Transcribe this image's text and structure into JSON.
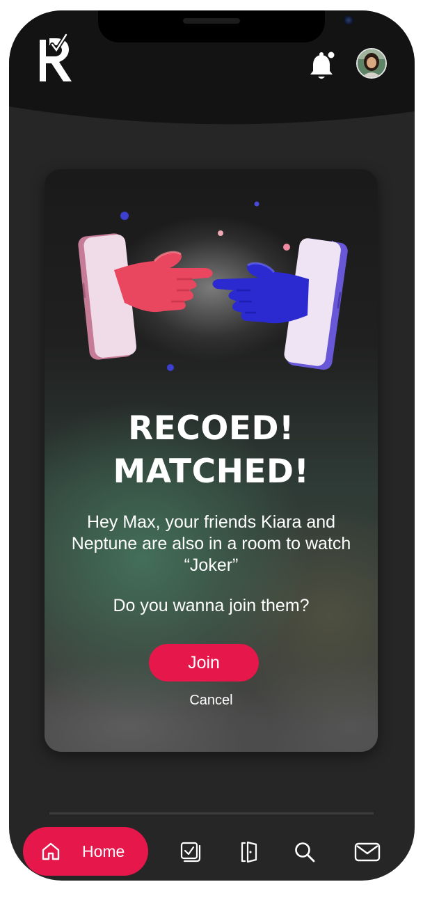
{
  "header": {
    "logo_letter": "R",
    "bell_icon": "bell-icon",
    "avatar_icon": "avatar"
  },
  "match_card": {
    "title_line1": "RECOED!",
    "title_line2": "MATCHED!",
    "message": "Hey Max, your friends Kiara and Neptune are also in a room to watch “Joker”",
    "question": "Do you wanna join them?",
    "join_label": "Join",
    "cancel_label": "Cancel"
  },
  "bottom_nav": {
    "home_label": "Home",
    "items": [
      {
        "icon": "home-icon",
        "label": "Home",
        "active": true
      },
      {
        "icon": "watchlist-icon"
      },
      {
        "icon": "door-icon"
      },
      {
        "icon": "search-icon"
      },
      {
        "icon": "mail-icon"
      }
    ]
  },
  "colors": {
    "accent": "#e5174b",
    "background": "#262626",
    "header": "#131313"
  }
}
